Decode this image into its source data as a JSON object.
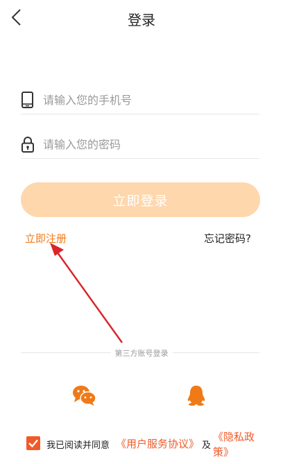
{
  "header": {
    "title": "登录"
  },
  "form": {
    "phone_placeholder": "请输入您的手机号",
    "password_placeholder": "请输入您的密码",
    "login_label": "立即登录"
  },
  "links": {
    "register": "立即注册",
    "forgot_password": "忘记密码?"
  },
  "third_party": {
    "label": "第三方账号登录",
    "providers": [
      "wechat-icon",
      "qq-icon"
    ]
  },
  "agreement": {
    "checked": true,
    "prefix": "我已阅读并同意",
    "service_link": "《用户服务协议》",
    "and": "及",
    "privacy_link_line1": "《隐私政",
    "privacy_link_line2": "策》"
  },
  "colors": {
    "accent": "#ef7a17",
    "button_bg": "#fed7ad",
    "agreement_accent": "#f05a28",
    "annotation_arrow": "#d9262a"
  }
}
